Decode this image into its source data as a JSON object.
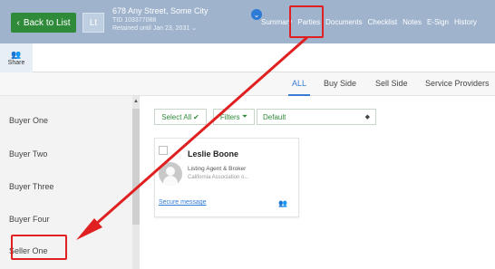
{
  "topbar": {
    "back_label": "Back to List",
    "thumb_label": "Lt",
    "address": "678 Any Street, Some City",
    "tid": "TID 103377088",
    "retained": "Retained until Jan 23, 2031",
    "nav": [
      "Summary",
      "Parties",
      "Documents",
      "Checklist",
      "Notes",
      "E-Sign",
      "History"
    ]
  },
  "toolbar": {
    "share_label": "Share"
  },
  "tabs": {
    "all": "ALL",
    "buy": "Buy Side",
    "sell": "Sell Side",
    "svc": "Service Providers"
  },
  "left_items": [
    "Buyer One",
    "Buyer Two",
    "Buyer Three",
    "Buyer Four",
    "Seller One"
  ],
  "actions": {
    "select_all": "Select All",
    "filters": "Filters",
    "default": "Default"
  },
  "card": {
    "name": "Leslie Boone",
    "role": "Listing Agent & Broker",
    "org": "California Association o...",
    "secure": "Secure message"
  },
  "colors": {
    "accent_green": "#2f8a3a",
    "topbar": "#9fb3cc",
    "highlight_red": "#e02020",
    "link_blue": "#2e7bd6"
  }
}
